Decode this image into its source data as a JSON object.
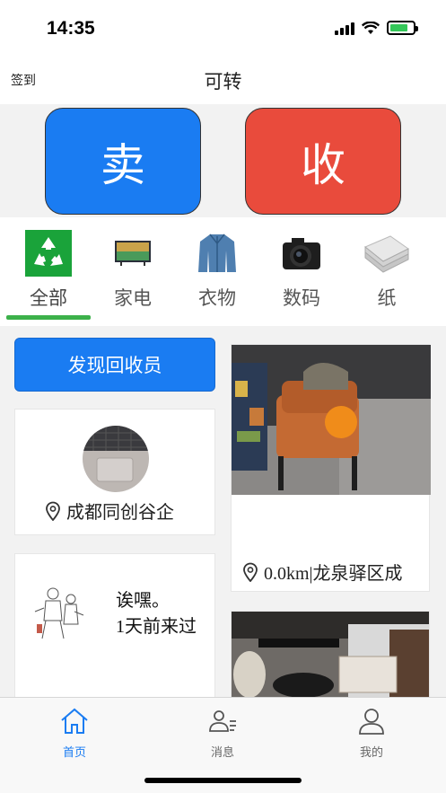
{
  "status_bar": {
    "time": "14:35"
  },
  "header": {
    "checkin_label": "签到",
    "title": "可转"
  },
  "actions": {
    "sell_label": "卖",
    "collect_label": "收"
  },
  "categories": [
    {
      "label": "全部",
      "icon": "recycle-icon",
      "active": true
    },
    {
      "label": "家电",
      "icon": "tv-icon"
    },
    {
      "label": "衣物",
      "icon": "jacket-icon"
    },
    {
      "label": "数码",
      "icon": "camera-icon"
    },
    {
      "label": "纸",
      "icon": "paper-icon"
    }
  ],
  "feed": {
    "discover_label": "发现回收员",
    "collector_card": {
      "location": "成都同创谷企"
    },
    "greeting_card": {
      "line1": "诶嘿。",
      "line2": "1天前来过"
    },
    "item_card": {
      "location": "0.0km|龙泉驿区成"
    }
  },
  "tab_bar": {
    "home_label": "首页",
    "messages_label": "消息",
    "profile_label": "我的"
  },
  "colors": {
    "sell": "#1a7cf2",
    "collect": "#e94b3c",
    "active_underline": "#3cb14a",
    "tab_active": "#1a7cf2"
  }
}
